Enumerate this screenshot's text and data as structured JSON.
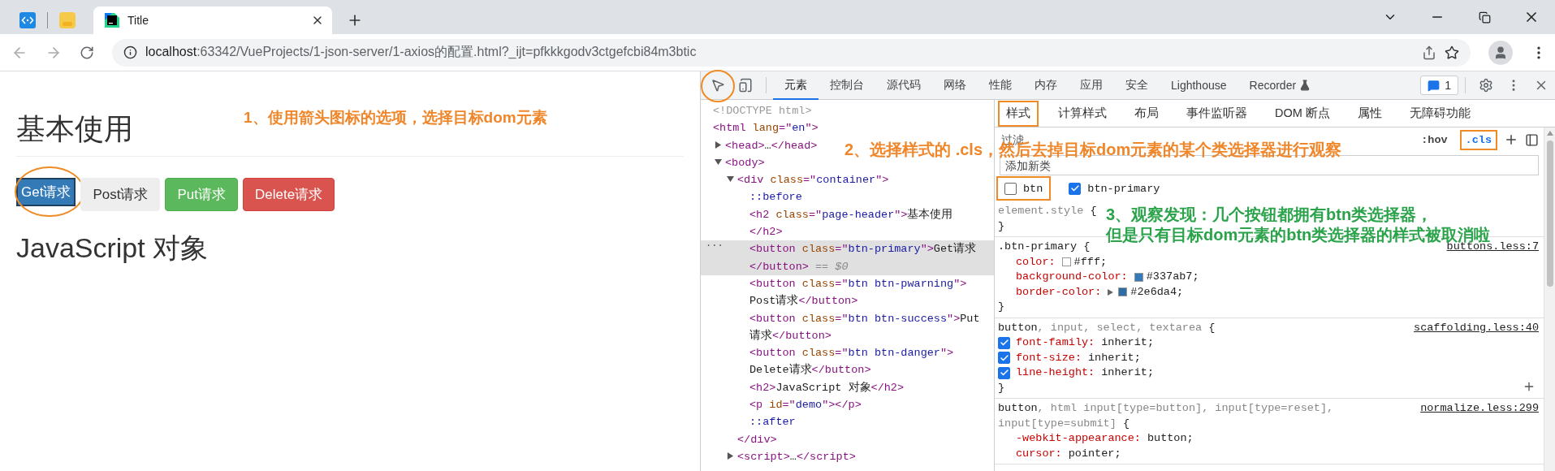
{
  "browser": {
    "tabs": [
      {
        "kind": "pinned",
        "selected": false
      },
      {
        "kind": "pinned",
        "selected": false
      },
      {
        "kind": "page",
        "title": "Title",
        "selected": true
      }
    ],
    "address": {
      "host": "localhost",
      "rest": ":63342/VueProjects/1-json-server/1-axios的配置.html?_ijt=pfkkkgodv3ctgefcbi84m3btic"
    }
  },
  "page": {
    "heading": "基本使用",
    "buttons": [
      {
        "label": "Get请求",
        "kind": "primary",
        "annotated": true
      },
      {
        "label": "Post请求",
        "kind": "default",
        "annotated": false
      },
      {
        "label": "Put请求",
        "kind": "success",
        "annotated": false
      },
      {
        "label": "Delete请求",
        "kind": "danger",
        "annotated": false
      }
    ],
    "subheading": "JavaScript 对象"
  },
  "devtools": {
    "inspect_annotated": true,
    "tabs": [
      {
        "label": "元素",
        "selected": true,
        "experimental": false
      },
      {
        "label": "控制台",
        "selected": false,
        "experimental": false
      },
      {
        "label": "源代码",
        "selected": false,
        "experimental": false
      },
      {
        "label": "网络",
        "selected": false,
        "experimental": false
      },
      {
        "label": "性能",
        "selected": false,
        "experimental": false
      },
      {
        "label": "内存",
        "selected": false,
        "experimental": false
      },
      {
        "label": "应用",
        "selected": false,
        "experimental": false
      },
      {
        "label": "安全",
        "selected": false,
        "experimental": false
      },
      {
        "label": "Lighthouse",
        "selected": false,
        "experimental": false
      },
      {
        "label": "Recorder",
        "selected": false,
        "experimental": true
      }
    ],
    "issues_count": "1",
    "elements": [
      {
        "selected": false,
        "lines": [
          [
            {
              "kind": "comment",
              "text": "<!DOCTYPE html>"
            }
          ]
        ]
      },
      {
        "selected": false,
        "lines": [
          [
            {
              "kind": "tag",
              "text": "<html"
            },
            {
              "kind": "attr",
              "text": " lang"
            },
            {
              "kind": "punct",
              "text": "=\""
            },
            {
              "kind": "value",
              "text": "en"
            },
            {
              "kind": "punct",
              "text": "\">"
            }
          ]
        ],
        "children": [
          {
            "selected": false,
            "expanded": false,
            "lines": [
              [
                {
                  "kind": "tag",
                  "text": "<head>"
                },
                {
                  "kind": "text",
                  "text": "…"
                },
                {
                  "kind": "tag",
                  "text": "</head>"
                }
              ]
            ]
          },
          {
            "selected": false,
            "expanded": true,
            "lines": [
              [
                {
                  "kind": "tag",
                  "text": "<body>"
                }
              ]
            ],
            "children": [
              {
                "selected": false,
                "expanded": true,
                "lines": [
                  [
                    {
                      "kind": "tag",
                      "text": "<div"
                    },
                    {
                      "kind": "attr",
                      "text": " class"
                    },
                    {
                      "kind": "punct",
                      "text": "=\""
                    },
                    {
                      "kind": "value",
                      "text": "container"
                    },
                    {
                      "kind": "punct",
                      "text": "\">"
                    }
                  ]
                ],
                "children": [
                  {
                    "selected": false,
                    "lines": [
                      [
                        {
                          "kind": "pseudo",
                          "text": "::before"
                        }
                      ]
                    ]
                  },
                  {
                    "selected": false,
                    "lines": [
                      [
                        {
                          "kind": "tag",
                          "text": "<h2"
                        },
                        {
                          "kind": "attr",
                          "text": " class"
                        },
                        {
                          "kind": "punct",
                          "text": "=\""
                        },
                        {
                          "kind": "value",
                          "text": "page-header"
                        },
                        {
                          "kind": "punct",
                          "text": "\">"
                        },
                        {
                          "kind": "text",
                          "text": "基本使用"
                        }
                      ],
                      [
                        {
                          "kind": "tag",
                          "text": "</h2>"
                        }
                      ]
                    ]
                  },
                  {
                    "selected": true,
                    "menu": "···",
                    "lines": [
                      [
                        {
                          "kind": "tag",
                          "text": "<button"
                        },
                        {
                          "kind": "attr",
                          "text": " class"
                        },
                        {
                          "kind": "punct",
                          "text": "=\""
                        },
                        {
                          "kind": "value",
                          "text": "btn-primary"
                        },
                        {
                          "kind": "punct",
                          "text": "\">"
                        },
                        {
                          "kind": "text",
                          "text": "Get请求"
                        }
                      ],
                      [
                        {
                          "kind": "tag",
                          "text": "</button>"
                        },
                        {
                          "kind": "dim",
                          "text": " == $0"
                        }
                      ]
                    ]
                  },
                  {
                    "selected": false,
                    "lines": [
                      [
                        {
                          "kind": "tag",
                          "text": "<button"
                        },
                        {
                          "kind": "attr",
                          "text": " class"
                        },
                        {
                          "kind": "punct",
                          "text": "=\""
                        },
                        {
                          "kind": "value",
                          "text": "btn btn-pwarning"
                        },
                        {
                          "kind": "punct",
                          "text": "\">"
                        }
                      ],
                      [
                        {
                          "kind": "text",
                          "text": "Post请求"
                        },
                        {
                          "kind": "tag",
                          "text": "</button>"
                        }
                      ]
                    ]
                  },
                  {
                    "selected": false,
                    "lines": [
                      [
                        {
                          "kind": "tag",
                          "text": "<button"
                        },
                        {
                          "kind": "attr",
                          "text": " class"
                        },
                        {
                          "kind": "punct",
                          "text": "=\""
                        },
                        {
                          "kind": "value",
                          "text": "btn btn-success"
                        },
                        {
                          "kind": "punct",
                          "text": "\">"
                        },
                        {
                          "kind": "text",
                          "text": "Put"
                        }
                      ],
                      [
                        {
                          "kind": "text",
                          "text": "请求"
                        },
                        {
                          "kind": "tag",
                          "text": "</button>"
                        }
                      ]
                    ]
                  },
                  {
                    "selected": false,
                    "lines": [
                      [
                        {
                          "kind": "tag",
                          "text": "<button"
                        },
                        {
                          "kind": "attr",
                          "text": " class"
                        },
                        {
                          "kind": "punct",
                          "text": "=\""
                        },
                        {
                          "kind": "value",
                          "text": "btn btn-danger"
                        },
                        {
                          "kind": "punct",
                          "text": "\">"
                        }
                      ],
                      [
                        {
                          "kind": "text",
                          "text": "Delete请求"
                        },
                        {
                          "kind": "tag",
                          "text": "</button>"
                        }
                      ]
                    ]
                  },
                  {
                    "selected": false,
                    "lines": [
                      [
                        {
                          "kind": "tag",
                          "text": "<h2>"
                        },
                        {
                          "kind": "text",
                          "text": "JavaScript 对象"
                        },
                        {
                          "kind": "tag",
                          "text": "</h2>"
                        }
                      ]
                    ]
                  },
                  {
                    "selected": false,
                    "lines": [
                      [
                        {
                          "kind": "tag",
                          "text": "<p"
                        },
                        {
                          "kind": "attr",
                          "text": " id"
                        },
                        {
                          "kind": "punct",
                          "text": "=\""
                        },
                        {
                          "kind": "value",
                          "text": "demo"
                        },
                        {
                          "kind": "punct",
                          "text": "\">"
                        },
                        {
                          "kind": "tag",
                          "text": "</p>"
                        }
                      ]
                    ]
                  },
                  {
                    "selected": false,
                    "lines": [
                      [
                        {
                          "kind": "pseudo",
                          "text": "::after"
                        }
                      ]
                    ]
                  }
                ],
                "closing": [
                  {
                    "kind": "tag",
                    "text": "</div>"
                  }
                ]
              },
              {
                "selected": false,
                "expanded": false,
                "lines": [
                  [
                    {
                      "kind": "tag",
                      "text": "<script>"
                    },
                    {
                      "kind": "text",
                      "text": "…"
                    },
                    {
                      "kind": "tag",
                      "text": "</script>"
                    }
                  ]
                ]
              }
            ]
          }
        ]
      }
    ],
    "styles": {
      "tabs": [
        {
          "label": "样式",
          "selected": true,
          "annotated": true
        },
        {
          "label": "计算样式",
          "selected": false,
          "annotated": false
        },
        {
          "label": "布局",
          "selected": false,
          "annotated": false
        },
        {
          "label": "事件监听器",
          "selected": false,
          "annotated": false
        },
        {
          "label": "DOM 断点",
          "selected": false,
          "annotated": false
        },
        {
          "label": "属性",
          "selected": false,
          "annotated": false
        },
        {
          "label": "无障碍功能",
          "selected": false,
          "annotated": false
        }
      ],
      "filter": {
        "placeholder": "过滤"
      },
      "toggles": [
        {
          "label": ":hov",
          "active": false,
          "annotated": false
        },
        {
          "label": ".cls",
          "active": true,
          "annotated": true
        }
      ],
      "add_class": {
        "placeholder": "添加新类"
      },
      "classes": [
        {
          "name": "btn",
          "checked": false,
          "annotated": true
        },
        {
          "name": "btn-primary",
          "checked": true,
          "annotated": false
        }
      ],
      "rules": [
        {
          "hovered": false,
          "selector": [
            [
              {
                "kind": "inactive",
                "text": "element.style"
              },
              {
                "kind": "plain",
                "text": " {"
              }
            ]
          ],
          "close": "}"
        },
        {
          "hovered": false,
          "selector": [
            [
              {
                "kind": "plain",
                "text": ".btn-primary {"
              }
            ]
          ],
          "source": "buttons.less:7",
          "declarations": [
            {
              "property": "color:",
              "value": "#fff;",
              "color": "#ffffff",
              "expandable": false
            },
            {
              "property": "background-color:",
              "value": "#337ab7;",
              "color": "#337ab7",
              "expandable": false
            },
            {
              "property": "border-color:",
              "value": "#2e6da4;",
              "color": "#2e6da4",
              "expandable": true
            }
          ],
          "close": "}"
        },
        {
          "hovered": true,
          "selector": [
            [
              {
                "kind": "plain",
                "text": "button"
              },
              {
                "kind": "inactive",
                "text": ", input, select, textarea"
              },
              {
                "kind": "plain",
                "text": " {"
              }
            ]
          ],
          "source": "scaffolding.less:40",
          "declarations": [
            {
              "property": "font-family:",
              "value": "inherit;",
              "checked": true
            },
            {
              "property": "font-size:",
              "value": "inherit;",
              "checked": true
            },
            {
              "property": "line-height:",
              "value": "inherit;",
              "checked": true
            }
          ],
          "close": "}"
        },
        {
          "hovered": false,
          "selector": [
            [
              {
                "kind": "plain",
                "text": "button"
              },
              {
                "kind": "inactive",
                "text": ", html input[type=button], input[type=reset],"
              }
            ],
            [
              {
                "kind": "inactive",
                "text": "input[type=submit]"
              },
              {
                "kind": "plain",
                "text": " {"
              }
            ]
          ],
          "source": "normalize.less:299",
          "declarations": [
            {
              "property": "-webkit-appearance:",
              "value": "button;"
            },
            {
              "property": "cursor:",
              "value": "pointer;"
            }
          ]
        }
      ]
    }
  },
  "annotations": [
    {
      "lines": [
        "1、使用箭头图标的选项，选择目标dom元素"
      ],
      "color": "#f0862a"
    },
    {
      "lines": [
        "2、选择样式的 .cls，然后去掉目标dom元素的某个类选择器进行观察"
      ],
      "color": "#f0862a"
    },
    {
      "lines": [
        "3、观察发现：几个按钮都拥有btn类选择器，",
        "但是只有目标dom元素的btn类选择器的样式被取消啦"
      ],
      "color": "#2aa34a"
    }
  ]
}
